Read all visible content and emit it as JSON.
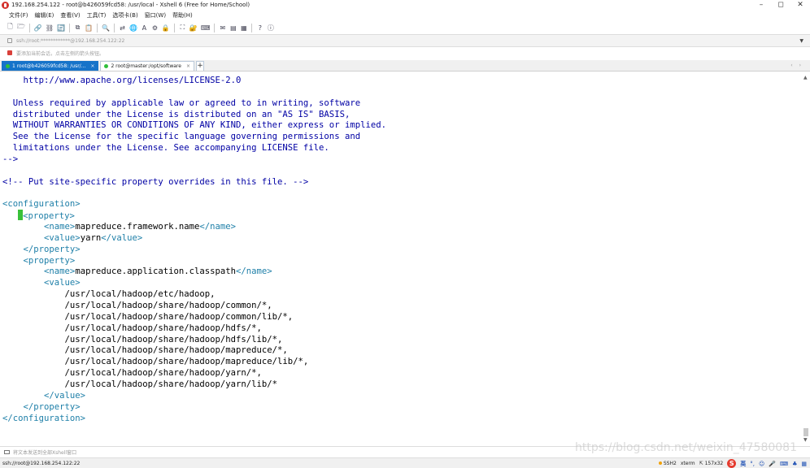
{
  "window": {
    "title": "192.168.254.122 - root@b426059fcd58: /usr/local - Xshell 6 (Free for Home/School)",
    "controls": {
      "minimize": "–",
      "maximize": "◻",
      "close": "✕"
    }
  },
  "menubar": [
    "文件(F)",
    "编辑(E)",
    "查看(V)",
    "工具(T)",
    "选项卡(B)",
    "窗口(W)",
    "帮助(H)"
  ],
  "toolbar": {
    "icons": [
      "new-session-icon",
      "open-folder-icon",
      "connect-icon",
      "disconnect-icon",
      "reconnect-icon",
      "copy-icon",
      "paste-icon",
      "find-icon",
      "transfer-icon",
      "globe-icon",
      "font-icon",
      "tunnel-icon",
      "lock-icon",
      "fullscreen-icon",
      "lock-screen-icon",
      "keyboard-icon",
      "compose-icon",
      "script-icon",
      "layout-icon",
      "help-icon",
      "info-icon"
    ],
    "glyphs": [
      "🗋",
      "🗁",
      "🔗",
      "⛓",
      "🔄",
      "⧉",
      "📋",
      "🔍",
      "⇄",
      "🌐",
      "A",
      "⚙",
      "🔒",
      "⛶",
      "🔐",
      "⌨",
      "✉",
      "▤",
      "▦",
      "?",
      "ⓘ"
    ]
  },
  "address": {
    "value": "ssh://root:************@192.168.254.122:22"
  },
  "infobar": {
    "text": "要添加当前会话，点击左侧的箭头按钮。"
  },
  "tabs": [
    {
      "label": "1 root@b426059fcd58: /usr/...",
      "active": true,
      "close": "×"
    },
    {
      "label": "2 root@master:/opt/software",
      "active": false,
      "close": "×"
    }
  ],
  "tab_add": "+",
  "tab_nav": "‹ ›",
  "terminal": {
    "lines": [
      {
        "text": "    http://www.apache.org/licenses/LICENSE-2.0",
        "color": "#0000a4"
      },
      {
        "text": "",
        "color": "#000"
      },
      {
        "text": "  Unless required by applicable law or agreed to in writing, software",
        "color": "#0000a4"
      },
      {
        "text": "  distributed under the License is distributed on an \"AS IS\" BASIS,",
        "color": "#0000a4"
      },
      {
        "text": "  WITHOUT WARRANTIES OR CONDITIONS OF ANY KIND, either express or implied.",
        "color": "#0000a4"
      },
      {
        "text": "  See the License for the specific language governing permissions and",
        "color": "#0000a4"
      },
      {
        "text": "  limitations under the License. See accompanying LICENSE file.",
        "color": "#0000a4"
      },
      {
        "text": "-->",
        "color": "#0000a4"
      },
      {
        "text": "",
        "color": "#000"
      },
      {
        "text": "<!-- Put site-specific property overrides in this file. -->",
        "color": "#0000a4"
      },
      {
        "text": "",
        "color": "#000"
      },
      {
        "text": "<configuration>",
        "color": "#1e7fa8"
      },
      {
        "indent": "    ",
        "cursor": true,
        "tag_open": "<property>",
        "color": "#1e7fa8"
      },
      {
        "indent": "        ",
        "tag_open": "<name>",
        "value": "mapreduce.framework.name",
        "tag_close": "</name>"
      },
      {
        "indent": "        ",
        "tag_open": "<value>",
        "value": "yarn",
        "tag_close": "</value>"
      },
      {
        "text": "    </property>",
        "color": "#1e7fa8"
      },
      {
        "text": "    <property>",
        "color": "#1e7fa8"
      },
      {
        "indent": "        ",
        "tag_open": "<name>",
        "value": "mapreduce.application.classpath",
        "tag_close": "</name>"
      },
      {
        "text": "        <value>",
        "color": "#1e7fa8"
      },
      {
        "text": "            /usr/local/hadoop/etc/hadoop,",
        "color": "#000"
      },
      {
        "text": "            /usr/local/hadoop/share/hadoop/common/*,",
        "color": "#000"
      },
      {
        "text": "            /usr/local/hadoop/share/hadoop/common/lib/*,",
        "color": "#000"
      },
      {
        "text": "            /usr/local/hadoop/share/hadoop/hdfs/*,",
        "color": "#000"
      },
      {
        "text": "            /usr/local/hadoop/share/hadoop/hdfs/lib/*,",
        "color": "#000"
      },
      {
        "text": "            /usr/local/hadoop/share/hadoop/mapreduce/*,",
        "color": "#000"
      },
      {
        "text": "            /usr/local/hadoop/share/hadoop/mapreduce/lib/*,",
        "color": "#000"
      },
      {
        "text": "            /usr/local/hadoop/share/hadoop/yarn/*,",
        "color": "#000"
      },
      {
        "text": "            /usr/local/hadoop/share/hadoop/yarn/lib/*",
        "color": "#000"
      },
      {
        "text": "        </value>",
        "color": "#1e7fa8"
      },
      {
        "text": "    </property>",
        "color": "#1e7fa8"
      },
      {
        "text": "</configuration>",
        "color": "#1e7fa8"
      }
    ]
  },
  "sendbar": {
    "text": "将文本发送到全部Xshell窗口"
  },
  "watermark": "https://blog.csdn.net/weixin_47580081",
  "statusbar": {
    "connection": "ssh://root@192.168.254.122:22",
    "protocol": "SSH2",
    "terminal_type": "xterm",
    "size": "157x32",
    "ime": "英"
  },
  "colors": {
    "tab_active": "#1673c9",
    "tag": "#1e7fa8",
    "comment": "#0000a4",
    "cursor": "#39c13a"
  }
}
